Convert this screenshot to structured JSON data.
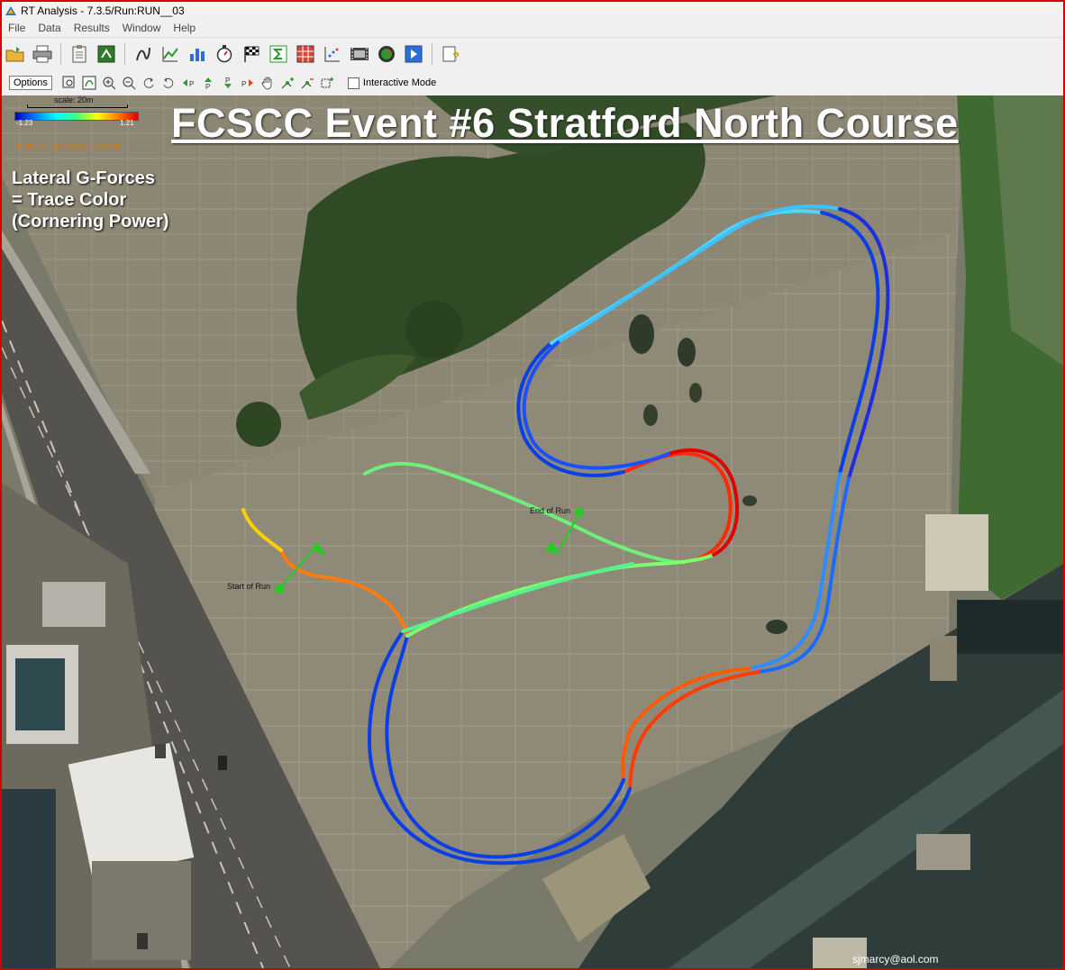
{
  "window": {
    "title": "RT Analysis - 7.3.5/Run:RUN__03"
  },
  "menu": [
    "File",
    "Data",
    "Results",
    "Window",
    "Help"
  ],
  "toolbar1": [
    "open-icon",
    "print-icon",
    "clipboard-icon",
    "export-icon",
    "graph-icon",
    "xy-graph-icon",
    "bar-chart-icon",
    "stopwatch-icon",
    "checkered-flag-icon",
    "sigma-icon",
    "grid-icon",
    "scatter-icon",
    "film-icon",
    "gauge-icon",
    "play-icon",
    "help-icon"
  ],
  "toolbar2": {
    "options_label": "Options",
    "icons": [
      "zoom-box-icon",
      "draw-icon",
      "zoom-in-icon",
      "zoom-out-icon",
      "rotate-left-icon",
      "rotate-right-icon",
      "step-back-icon",
      "step-up-icon",
      "step-down-icon",
      "step-forward-icon",
      "pan-hand-icon",
      "add-point-icon",
      "remove-point-icon",
      "add-region-icon"
    ],
    "interactive_mode_label": "Interactive Mode",
    "interactive_mode_checked": false
  },
  "map": {
    "overlay_title": "FCSCC Event #6 Stratford North Course",
    "legend_lines": [
      "Lateral G-Forces",
      "= Trace Color",
      "(Cornering Power)"
    ],
    "scale_label": "scale: 20m",
    "gradient_min": "-1.23",
    "gradient_max": "1.21",
    "run_label": "R. RUN__03. 0.00 to 1:45.08",
    "start_label": "Start of Run",
    "end_label": "End of Run",
    "email": "sjmarcy@aol.com",
    "colors": {
      "low": "#0000c8",
      "mid": "#40ff80",
      "high": "#e00000",
      "start_end_marker": "#22cc22"
    }
  }
}
